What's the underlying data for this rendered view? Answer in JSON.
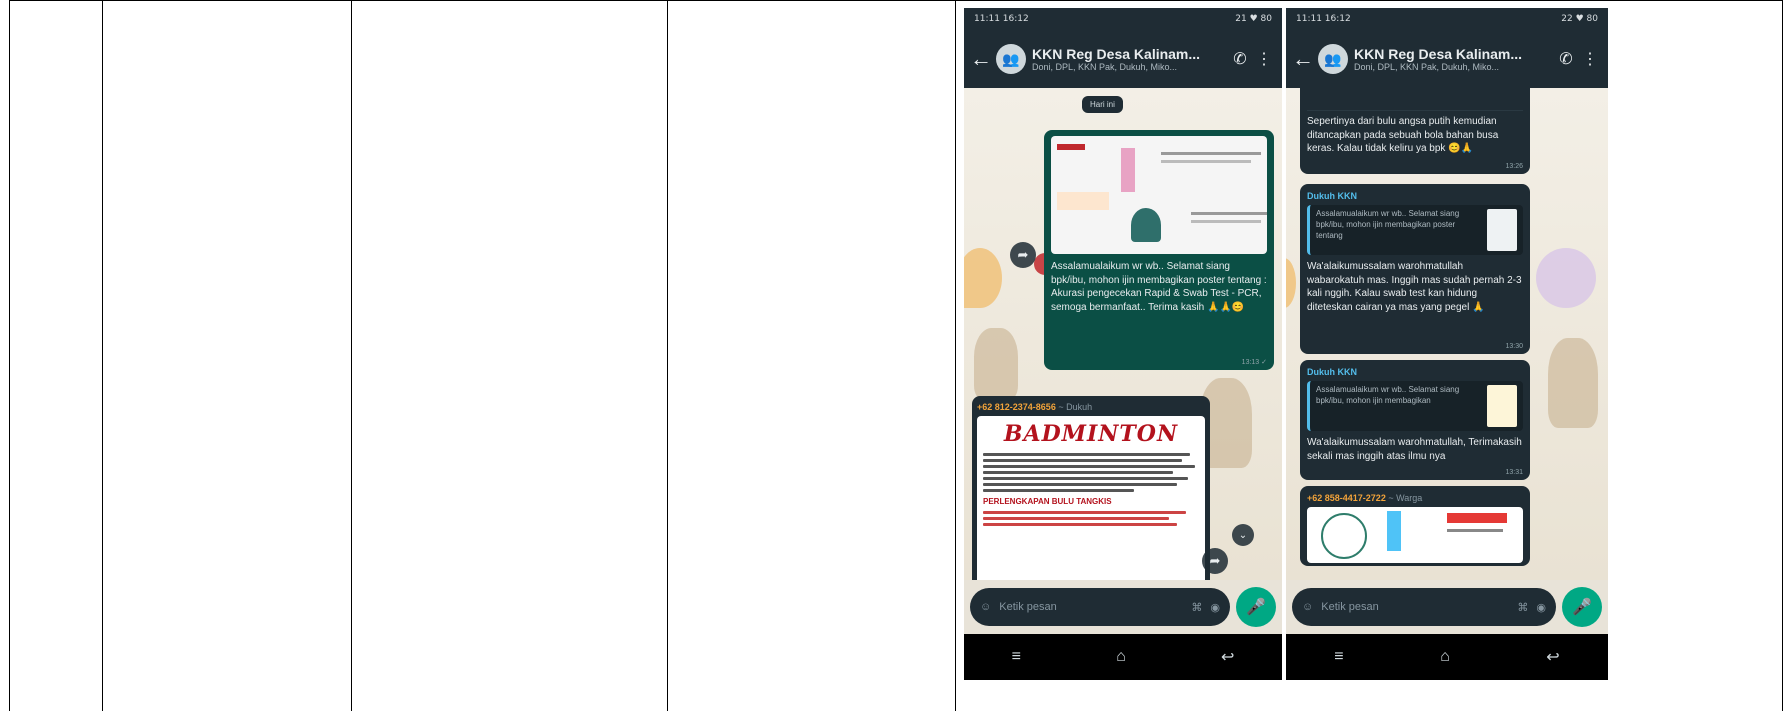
{
  "phone_left": {
    "status": {
      "time": "11:11 16:12",
      "indicators": "21 ♥ 80"
    },
    "title": "KKN Reg Desa Kalinam...",
    "subtitle": "Doni, DPL, KKN Pak, Dukuh, Miko...",
    "date_chip": "Hari ini",
    "bubble1": {
      "text": "Assalamualaikum wr wb.. Selamat siang bpk/ibu, mohon ijin membagikan poster tentang : Akurasi pengecekan Rapid & Swab Test - PCR, semoga bermanfaat.. Terima kasih 🙏🙏😊",
      "time": "13:13 ✓"
    },
    "bubble2": {
      "sender": "+62 812-2374-8656",
      "sender_note": "~ Dukuh",
      "poster_title": "BADMINTON",
      "poster_sub": "PERLENGKAPAN BULU TANGKIS"
    },
    "input_placeholder": "Ketik pesan"
  },
  "phone_right": {
    "status": {
      "time": "11:11 16:12",
      "indicators": "22 ♥ 80"
    },
    "title": "KKN Reg Desa Kalinam...",
    "subtitle": "Doni, DPL, KKN Pak, Dukuh, Miko...",
    "bubble0": {
      "text": "Sepertinya dari bulu angsa putih kemudian ditancapkan pada sebuah bola bahan busa keras. Kalau tidak keliru ya bpk 😊🙏",
      "time": "13:26"
    },
    "bubble1": {
      "sender": "Dukuh KKN",
      "quote": "Assalamualaikum wr wb.. Selamat siang bpk/ibu, mohon ijin membagikan poster tentang",
      "text": "Wa'alaikumussalam warohmatullah wabarokatuh mas. Inggih mas sudah pernah 2-3 kali nggih. Kalau swab test kan hidung diteteskan cairan ya mas yang pegel 🙏",
      "time": "13:30"
    },
    "bubble2": {
      "sender": "Dukuh KKN",
      "quote": "Assalamualaikum wr wb.. Selamat siang bpk/ibu, mohon ijin membagikan",
      "text": "Wa'alaikumussalam warohmatullah, Terimakasih sekali mas inggih atas ilmu nya",
      "time": "13:31"
    },
    "bubble3": {
      "sender": "+62 858-4417-2722",
      "sender_note": "~ Warga"
    },
    "input_placeholder": "Ketik pesan"
  },
  "icons": {
    "back": "←",
    "call": "✆",
    "menu": "⋮",
    "emoji": "☺",
    "attach": "⌘",
    "camera": "◉",
    "mic": "🎤",
    "forward": "➦",
    "nav_menu": "≡",
    "nav_home": "⌂",
    "nav_back": "↩"
  }
}
